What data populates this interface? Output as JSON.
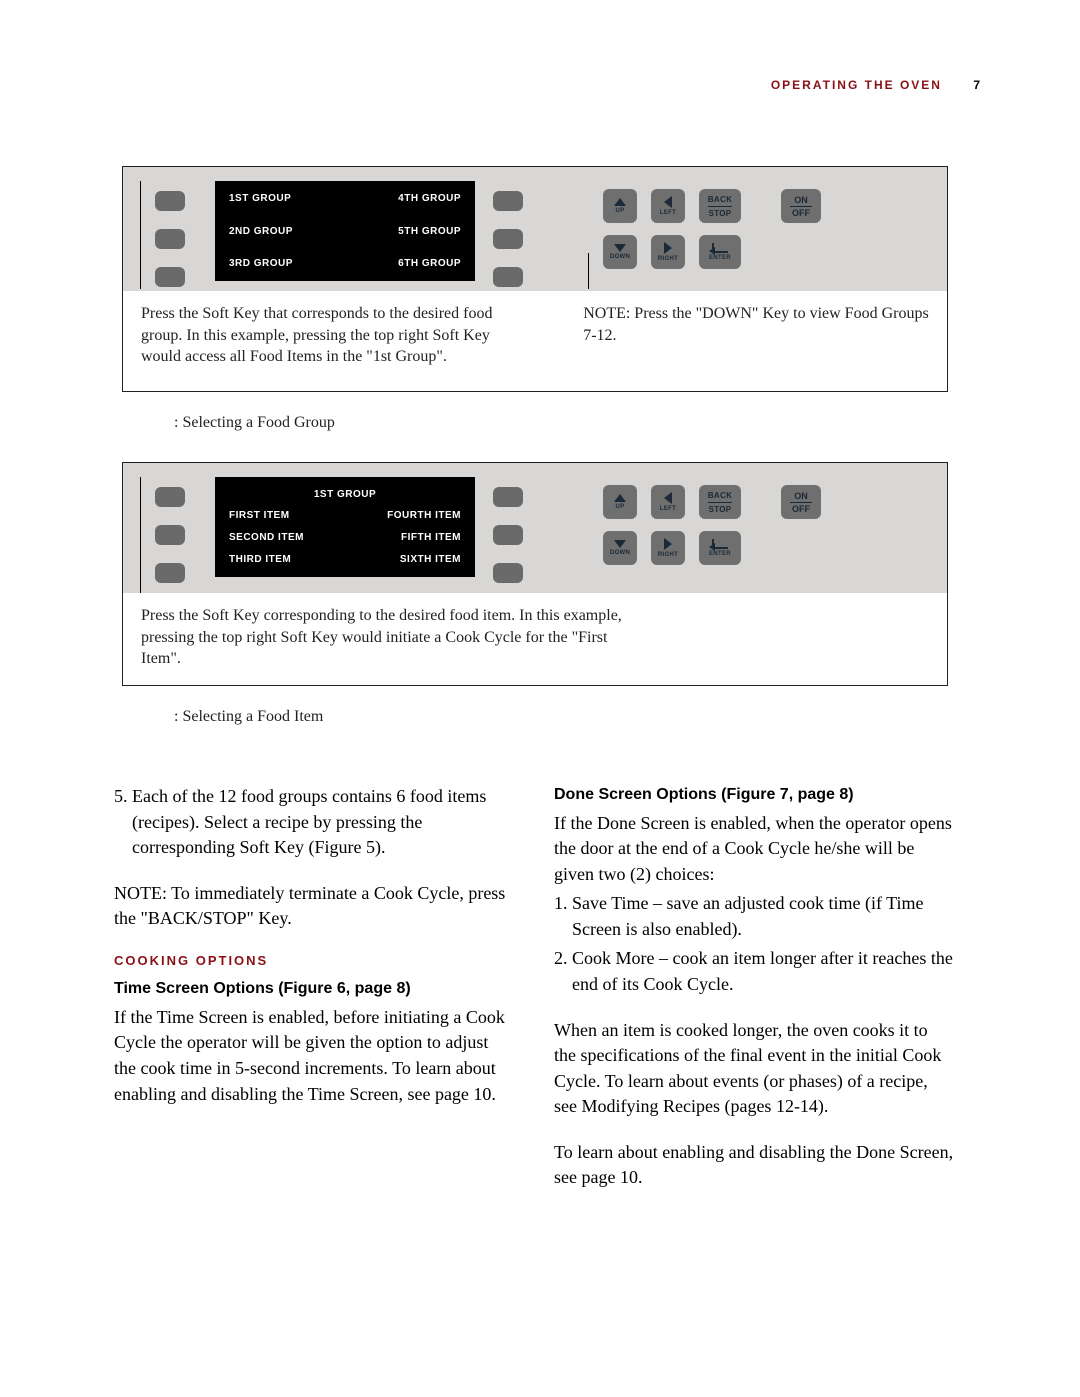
{
  "header": {
    "section": "OPERATING THE OVEN",
    "page": "7"
  },
  "fig1": {
    "lcd": {
      "rows": [
        {
          "left": "1ST GROUP",
          "right": "4TH GROUP"
        },
        {
          "left": "2ND GROUP",
          "right": "5TH GROUP"
        },
        {
          "left": "3RD GROUP",
          "right": "6TH GROUP"
        }
      ]
    },
    "note_left": "Press the Soft Key that corresponds to the desired food group. In this example, pressing the top right Soft Key would access all Food Items in the \"1st Group\".",
    "note_right": "NOTE: Press the \"DOWN\" Key to view Food Groups 7-12.",
    "caption": ": Selecting a Food Group"
  },
  "fig2": {
    "lcd": {
      "title": "1ST GROUP",
      "rows": [
        {
          "left": "FIRST ITEM",
          "right": "FOURTH ITEM"
        },
        {
          "left": "SECOND ITEM",
          "right": "FIFTH ITEM"
        },
        {
          "left": "THIRD ITEM",
          "right": "SIXTH ITEM"
        }
      ]
    },
    "note_left": "Press the Soft Key corresponding to the desired food item. In this example, pressing the top right Soft Key would initiate a Cook Cycle for the \"First Item\".",
    "caption": ": Selecting a Food Item"
  },
  "nav": {
    "up": "UP",
    "down": "DOWN",
    "left": "LEFT",
    "right": "RIGHT",
    "back": "BACK",
    "stop": "STOP",
    "enter": "ENTER",
    "on": "ON",
    "off": "OFF"
  },
  "body": {
    "left": {
      "p1": "5. Each of the 12 food groups contains 6 food items (recipes). Select a recipe by pressing the corresponding Soft Key (Figure 5).",
      "p2": "NOTE: To immediately terminate a Cook Cycle, press the \"BACK/STOP\" Key.",
      "sec": "COOKING OPTIONS",
      "h1": "Time Screen Options (Figure 6, page 8)",
      "p3": "If the Time Screen is enabled, before initiating a Cook Cycle the operator will be given the option to adjust the cook time in 5-second increments. To learn about enabling and disabling the Time Screen, see page 10."
    },
    "right": {
      "h1": "Done Screen Options (Figure 7, page 8)",
      "p1": "If the Done Screen is enabled, when the operator opens the door at the end of a Cook Cycle he/she will be given two (2) choices:",
      "li1": "1. Save Time – save an adjusted cook time (if Time Screen is also enabled).",
      "li2": "2. Cook More – cook an item longer after it reaches the end of its Cook Cycle.",
      "p2": "When an item is cooked longer, the oven cooks it to the specifications of the final event in the initial Cook Cycle. To learn about events (or phases) of a recipe, see Modifying Recipes (pages 12-14).",
      "p3": "To learn about enabling and disabling the Done Screen, see page 10."
    }
  }
}
